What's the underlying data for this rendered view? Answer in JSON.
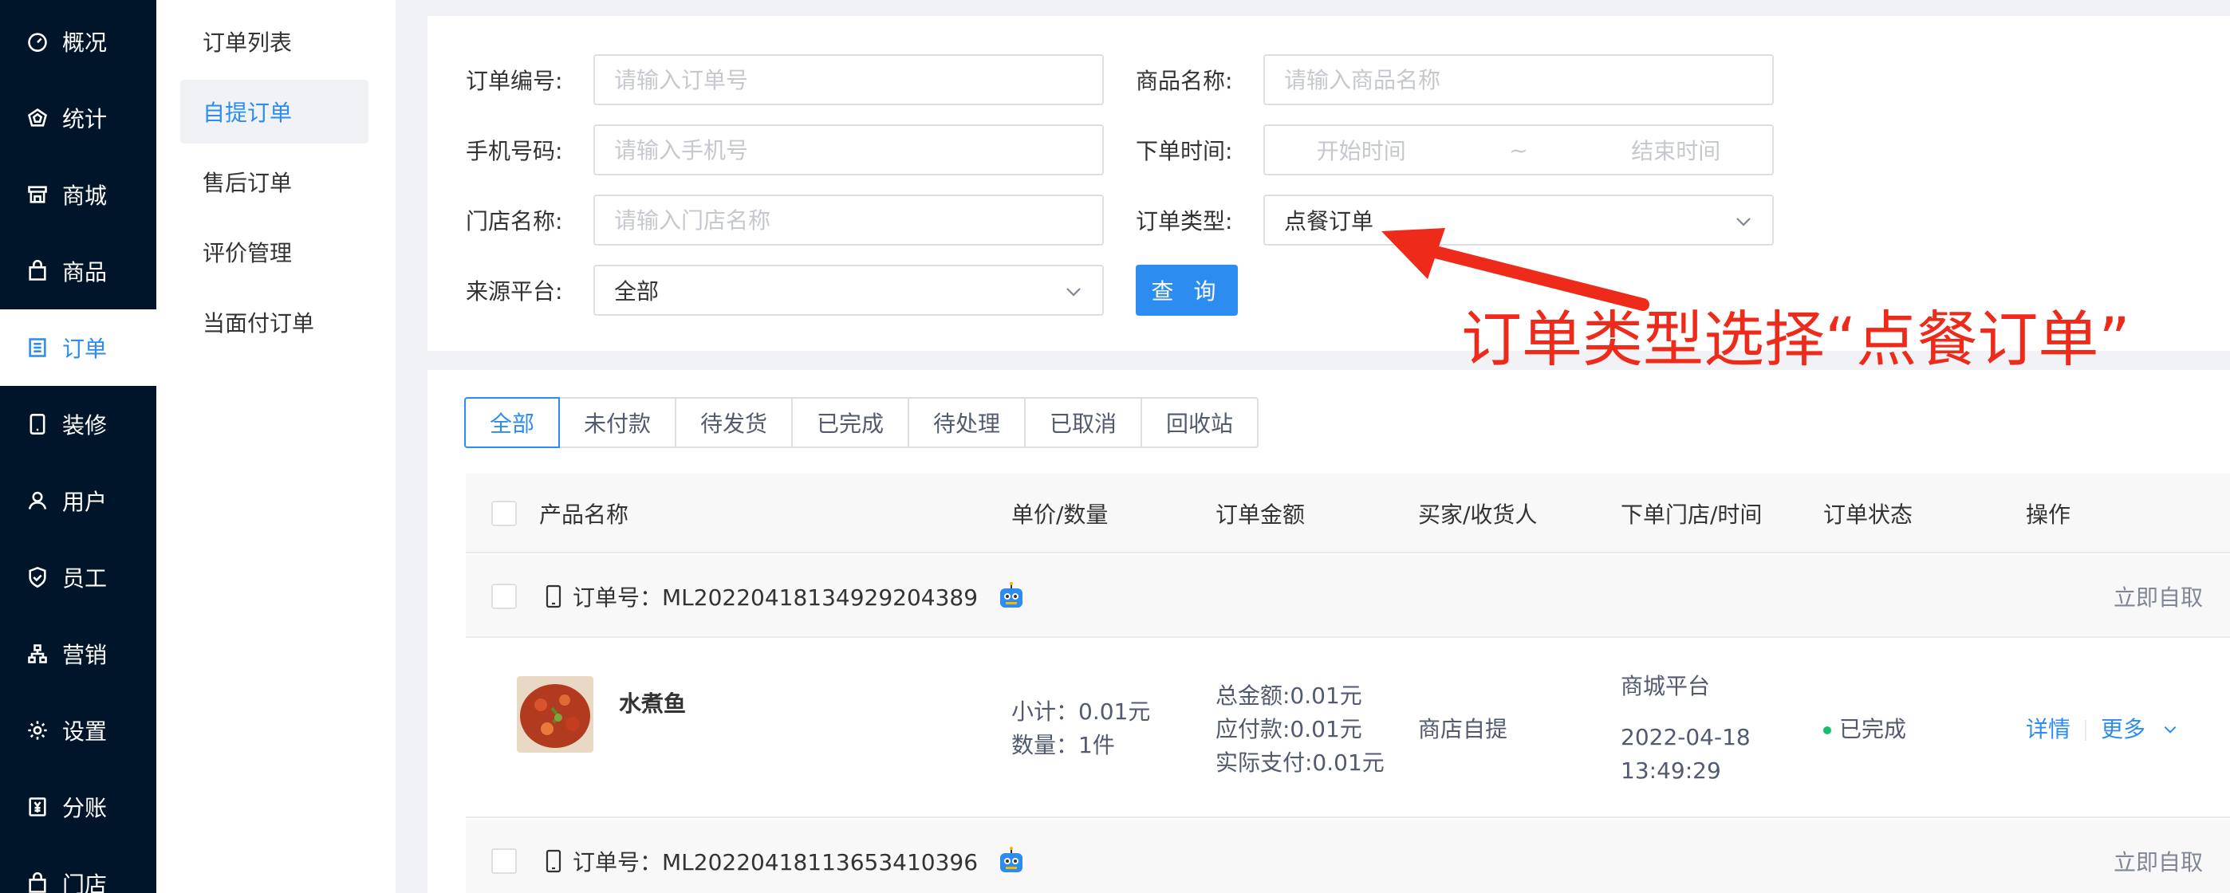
{
  "sidebar": {
    "items": [
      {
        "label": "概况",
        "icon": "dashboard-icon"
      },
      {
        "label": "统计",
        "icon": "stats-icon"
      },
      {
        "label": "商城",
        "icon": "store-icon"
      },
      {
        "label": "商品",
        "icon": "bag-icon"
      },
      {
        "label": "订单",
        "icon": "list-icon",
        "active": true
      },
      {
        "label": "装修",
        "icon": "tablet-icon"
      },
      {
        "label": "用户",
        "icon": "user-icon"
      },
      {
        "label": "员工",
        "icon": "shield-icon"
      },
      {
        "label": "营销",
        "icon": "network-icon"
      },
      {
        "label": "设置",
        "icon": "gear-icon"
      },
      {
        "label": "分账",
        "icon": "yen-icon"
      },
      {
        "label": "门店",
        "icon": "shop-icon"
      }
    ]
  },
  "submenu": {
    "items": [
      {
        "label": "订单列表"
      },
      {
        "label": "自提订单",
        "active": true
      },
      {
        "label": "售后订单"
      },
      {
        "label": "评价管理"
      },
      {
        "label": "当面付订单"
      }
    ]
  },
  "filters": {
    "order_no_label": "订单编号:",
    "order_no_placeholder": "请输入订单号",
    "product_name_label": "商品名称:",
    "product_name_placeholder": "请输入商品名称",
    "phone_label": "手机号码:",
    "phone_placeholder": "请输入手机号",
    "order_time_label": "下单时间:",
    "start_time": "开始时间",
    "range_sep": "~",
    "end_time": "结束时间",
    "store_label": "门店名称:",
    "store_placeholder": "请输入门店名称",
    "order_type_label": "订单类型:",
    "order_type_value": "点餐订单",
    "source_label": "来源平台:",
    "source_value": "全部",
    "query_button": "查 询"
  },
  "annotation": {
    "text": "订单类型选择“点餐订单”",
    "color": "#ee2a1b"
  },
  "tabs": [
    "全部",
    "未付款",
    "待发货",
    "已完成",
    "待处理",
    "已取消",
    "回收站"
  ],
  "table": {
    "headers": {
      "product": "产品名称",
      "price_qty": "单价/数量",
      "amount": "订单金额",
      "buyer": "买家/收货人",
      "store_time": "下单门店/时间",
      "status": "订单状态",
      "actions": "操作"
    },
    "orders": [
      {
        "order_no": "订单号：ML20220418134929204389",
        "pickup_action": "立即自取",
        "product_name": "水煮鱼",
        "subtotal": "小计：0.01元",
        "quantity": "数量：1件",
        "total": "总金额:0.01元",
        "payable": "应付款:0.01元",
        "paid": "实际支付:0.01元",
        "buyer": "商店自提",
        "store": "商城平台",
        "date": "2022-04-18",
        "time": "13:49:29",
        "status": "已完成",
        "detail_link": "详情",
        "more_link": "更多"
      },
      {
        "order_no": "订单号：ML20220418113653410396",
        "pickup_action": "立即自取"
      }
    ]
  },
  "colors": {
    "primary": "#2d8cf0",
    "sidebar_bg": "#001529",
    "success": "#19be6b"
  }
}
